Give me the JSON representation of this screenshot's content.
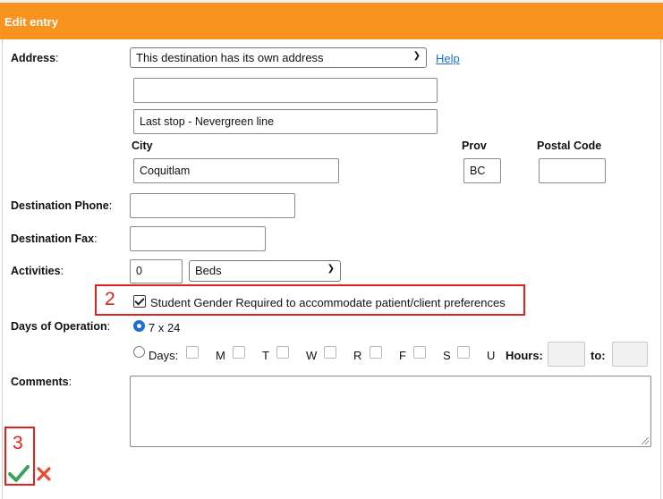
{
  "dialog": {
    "title": "Edit entry"
  },
  "address": {
    "label": "Address",
    "select_value": "This destination has its own address",
    "help_link": "Help",
    "line1_value": "",
    "line2_value": "Last stop - Nevergreen line",
    "city_label": "City",
    "city_value": "Coquitlam",
    "prov_label": "Prov",
    "prov_value": "BC",
    "postal_label": "Postal Code",
    "postal_value": ""
  },
  "phone": {
    "label": "Destination Phone",
    "value": ""
  },
  "fax": {
    "label": "Destination Fax",
    "value": ""
  },
  "activities": {
    "label": "Activities",
    "count_value": "0",
    "type_value": "Beds",
    "gender_checkbox_label": "Student Gender Required to accommodate patient/client preferences",
    "gender_checked": true
  },
  "days_of_operation": {
    "label": "Days of Operation",
    "option_24": "7 x 24",
    "option_days": "Days:",
    "days": [
      "M",
      "T",
      "W",
      "R",
      "F",
      "S",
      "U"
    ],
    "hours_label": "Hours:",
    "to_label": "to:"
  },
  "comments": {
    "label": "Comments",
    "value": ""
  },
  "annotations": {
    "callout_2": "2",
    "callout_3": "3"
  },
  "colors": {
    "header": "#f7931e",
    "accent": "#1a6fd1",
    "callout": "#e0231d",
    "save": "#3aa35b",
    "cancel": "#e8492f"
  },
  "icons": {
    "save": "checkmark-icon",
    "cancel": "x-icon"
  }
}
